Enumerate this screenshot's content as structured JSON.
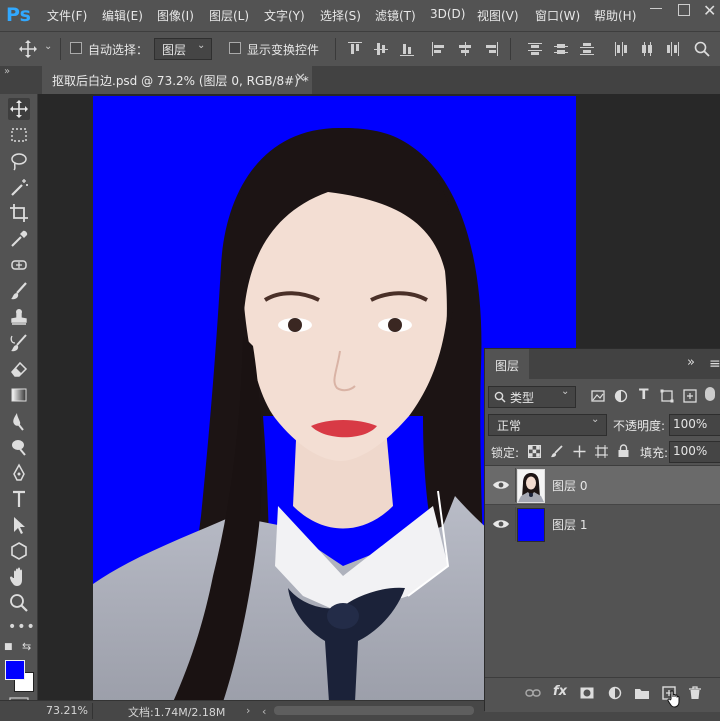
{
  "app": {
    "logo": "Ps"
  },
  "menu": {
    "items": [
      "文件(F)",
      "编辑(E)",
      "图像(I)",
      "图层(L)",
      "文字(Y)",
      "选择(S)",
      "滤镜(T)",
      "3D(D)",
      "视图(V)",
      "窗口(W)",
      "帮助(H)"
    ]
  },
  "options": {
    "auto_select_label": "自动选择：",
    "auto_select_value": "图层",
    "show_transform_label": "显示变换控件"
  },
  "document": {
    "tab_title": "抠取后白边.psd @ 73.2% (图层 0, RGB/8#) *",
    "canvas_color": "#0000ff"
  },
  "toolbar": {
    "foreground_color": "#0000ff",
    "background_color": "#ffffff"
  },
  "status": {
    "zoom": "73.21%",
    "doc_size": "文档:1.74M/2.18M"
  },
  "layers_panel": {
    "title": "图层",
    "filter_kind": "类型",
    "blend_mode": "正常",
    "opacity_label": "不透明度:",
    "opacity_value": "100%",
    "lock_label": "锁定:",
    "fill_label": "填充:",
    "fill_value": "100%",
    "layers": [
      {
        "name": "图层 0",
        "selected": true,
        "thumb": "portrait"
      },
      {
        "name": "图层 1",
        "selected": false,
        "thumb": "#0000ff"
      }
    ]
  }
}
